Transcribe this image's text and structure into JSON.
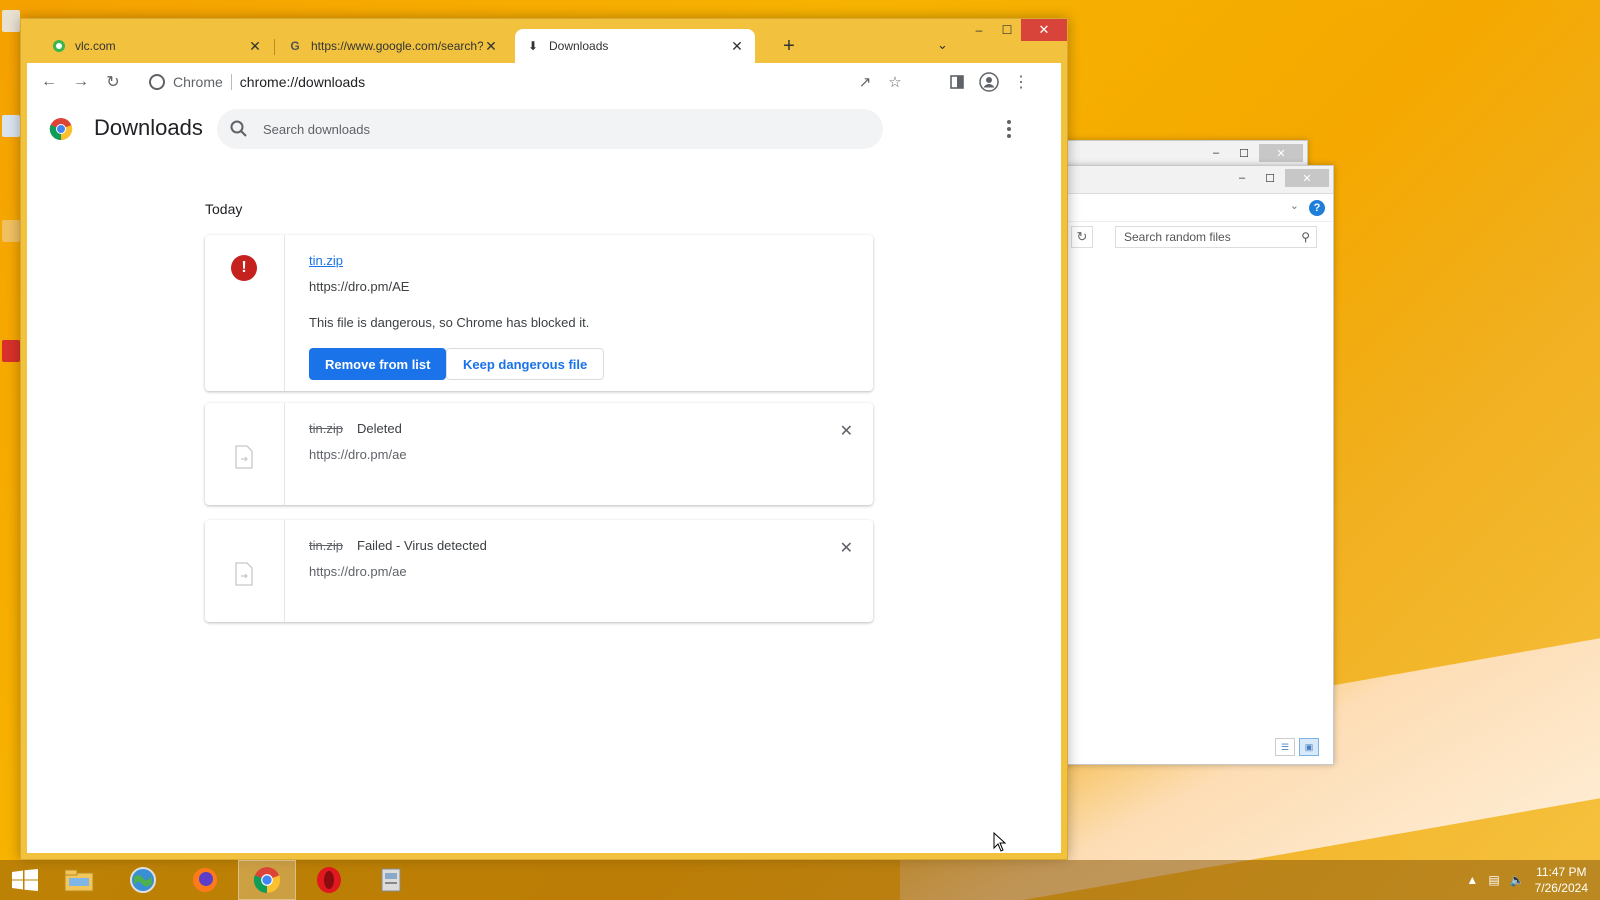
{
  "browser": {
    "tabs": [
      {
        "title": "vlc.com",
        "favicon": "vlc-icon"
      },
      {
        "title": "https://www.google.com/search?",
        "favicon": "google-icon"
      },
      {
        "title": "Downloads",
        "favicon": "download-icon"
      }
    ],
    "omnibox": {
      "site_label": "Chrome",
      "url": "chrome://downloads"
    }
  },
  "downloads_page": {
    "title": "Downloads",
    "search_placeholder": "Search downloads",
    "section_label": "Today",
    "items": [
      {
        "filename": "tin.zip",
        "url": "https://dro.pm/AE",
        "warning": "This file is dangerous, so Chrome has blocked it.",
        "primary_action": "Remove from list",
        "secondary_action": "Keep dangerous file"
      },
      {
        "filename": "tin.zip",
        "status": "Deleted",
        "url": "https://dro.pm/ae"
      },
      {
        "filename": "tin.zip",
        "status": "Failed - Virus detected",
        "url": "https://dro.pm/ae"
      }
    ]
  },
  "explorer": {
    "search_placeholder": "Search random files"
  },
  "taskbar": {
    "apps": [
      "file-explorer-icon",
      "globe-icon",
      "firefox-icon",
      "chrome-icon",
      "opera-icon",
      "installer-icon"
    ],
    "clock_time": "11:47 PM",
    "clock_date": "7/26/2024"
  },
  "colors": {
    "accent_blue": "#1a73e8",
    "danger_red": "#c5221f",
    "chrome_frame": "#f2c23e",
    "close_red": "#d9443a"
  }
}
